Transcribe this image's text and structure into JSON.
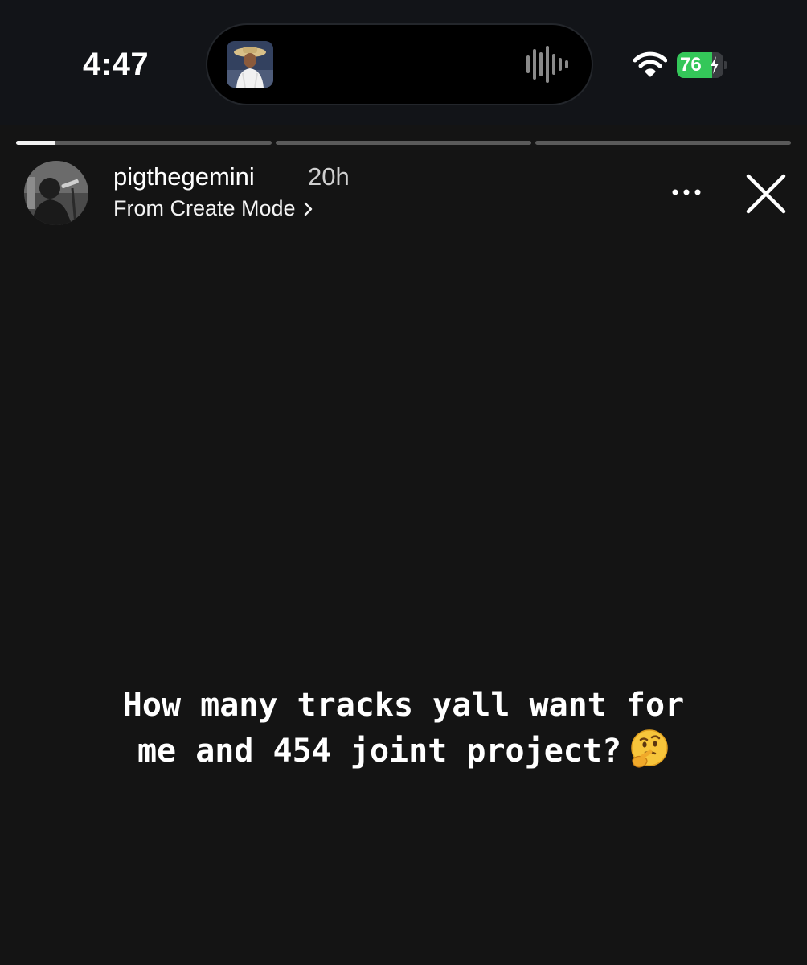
{
  "status_bar": {
    "time": "4:47",
    "battery_percent": "76",
    "battery_level": 0.76,
    "battery_charging": true,
    "wifi_icon": "wifi-icon",
    "now_playing_icon": "waveform-icon"
  },
  "story": {
    "progress_segments": [
      {
        "fill": 0.15
      },
      {
        "fill": 0.0
      },
      {
        "fill": 0.0
      }
    ],
    "username": "pigthegemini",
    "time_ago": "20h",
    "source_label": "From Create Mode",
    "text_lines": [
      "How many tracks yall want for",
      "me and 454 joint project?"
    ],
    "emoji": "thinking-face",
    "more_icon": "more-options-icon",
    "close_icon": "close-icon"
  },
  "colors": {
    "background": "#141414",
    "status_background": "#121418",
    "battery_green": "#34c759",
    "progress_track": "#5a5a5a",
    "progress_fill": "#f2f2f2"
  }
}
